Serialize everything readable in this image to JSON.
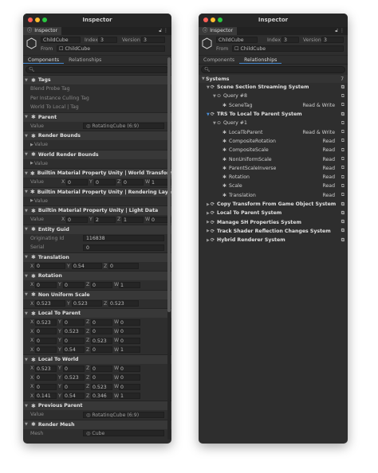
{
  "left": {
    "title": "Inspector",
    "tab_label": "Inspector",
    "entity": {
      "name": "ChildCube",
      "index_label": "Index",
      "index_value": "3",
      "version_label": "Version",
      "version_value": "3",
      "from_label": "From",
      "from_value": "ChildCube"
    },
    "subtabs": [
      "Components",
      "Relationships"
    ],
    "components": [
      {
        "name": "Tags",
        "rows": [
          {
            "text": "Blend Probe Tag"
          },
          {
            "text": "Per Instance Culling Tag"
          },
          {
            "text": "World To Local | Tag"
          }
        ]
      },
      {
        "name": "Parent",
        "rows": [
          {
            "label": "Value",
            "object": "RotatingCube (6:9)"
          }
        ]
      },
      {
        "name": "Render Bounds",
        "rows": [
          {
            "label": "Value",
            "collapsed": true
          }
        ]
      },
      {
        "name": "World Render Bounds",
        "rows": [
          {
            "label": "Value",
            "collapsed": true
          }
        ]
      },
      {
        "name": "Builtin Material Property Unity | World Transform P...",
        "rows": [
          {
            "label": "Value",
            "vec": [
              [
                "X",
                "0"
              ],
              [
                "Y",
                "0"
              ],
              [
                "Z",
                "0"
              ],
              [
                "W",
                "1"
              ]
            ]
          }
        ]
      },
      {
        "name": "Builtin Material Property Unity | Rendering Layer",
        "rows": [
          {
            "label": "Value",
            "collapsed": true
          }
        ]
      },
      {
        "name": "Builtin Material Property Unity | Light Data",
        "rows": [
          {
            "label": "Value",
            "vec": [
              [
                "X",
                "0"
              ],
              [
                "Y",
                "2"
              ],
              [
                "Z",
                "1"
              ],
              [
                "W",
                "0"
              ]
            ]
          }
        ]
      },
      {
        "name": "Entity Guid",
        "rows": [
          {
            "label": "Originating Id",
            "value": "116838"
          },
          {
            "label": "Serial",
            "value": "0"
          }
        ]
      },
      {
        "name": "Translation",
        "rows": [
          {
            "vec": [
              [
                "X",
                "0"
              ],
              [
                "Y",
                "0.54"
              ],
              [
                "Z",
                "0"
              ]
            ]
          }
        ]
      },
      {
        "name": "Rotation",
        "rows": [
          {
            "vec": [
              [
                "X",
                "0"
              ],
              [
                "Y",
                "0"
              ],
              [
                "Z",
                "0"
              ],
              [
                "W",
                "1"
              ]
            ]
          }
        ]
      },
      {
        "name": "Non Uniform Scale",
        "rows": [
          {
            "vec": [
              [
                "X",
                "0.523"
              ],
              [
                "Y",
                "0.523"
              ],
              [
                "Z",
                "0.523"
              ]
            ]
          }
        ]
      },
      {
        "name": "Local To Parent",
        "rows": [
          {
            "vec": [
              [
                "X",
                "0.523"
              ],
              [
                "Y",
                "0"
              ],
              [
                "Z",
                "0"
              ],
              [
                "W",
                "0"
              ]
            ]
          },
          {
            "vec": [
              [
                "X",
                "0"
              ],
              [
                "Y",
                "0.523"
              ],
              [
                "Z",
                "0"
              ],
              [
                "W",
                "0"
              ]
            ]
          },
          {
            "vec": [
              [
                "X",
                "0"
              ],
              [
                "Y",
                "0"
              ],
              [
                "Z",
                "0.523"
              ],
              [
                "W",
                "0"
              ]
            ]
          },
          {
            "vec": [
              [
                "X",
                "0"
              ],
              [
                "Y",
                "0.54"
              ],
              [
                "Z",
                "0"
              ],
              [
                "W",
                "1"
              ]
            ]
          }
        ]
      },
      {
        "name": "Local To World",
        "rows": [
          {
            "vec": [
              [
                "X",
                "0.523"
              ],
              [
                "Y",
                "0"
              ],
              [
                "Z",
                "0"
              ],
              [
                "W",
                "0"
              ]
            ]
          },
          {
            "vec": [
              [
                "X",
                "0"
              ],
              [
                "Y",
                "0.523"
              ],
              [
                "Z",
                "0"
              ],
              [
                "W",
                "0"
              ]
            ]
          },
          {
            "vec": [
              [
                "X",
                "0"
              ],
              [
                "Y",
                "0"
              ],
              [
                "Z",
                "0.523"
              ],
              [
                "W",
                "0"
              ]
            ]
          },
          {
            "vec": [
              [
                "X",
                "0.141"
              ],
              [
                "Y",
                "0.54"
              ],
              [
                "Z",
                "0.346"
              ],
              [
                "W",
                "1"
              ]
            ]
          }
        ]
      },
      {
        "name": "Previous Parent",
        "rows": [
          {
            "label": "Value",
            "object": "RotatingCube (6:9)"
          }
        ]
      },
      {
        "name": "Render Mesh",
        "rows": [
          {
            "label": "Mesh",
            "object": "Cube"
          }
        ]
      }
    ]
  },
  "right": {
    "title": "Inspector",
    "tab_label": "Inspector",
    "entity": {
      "name": "ChildCube",
      "index_label": "Index",
      "index_value": "3",
      "version_label": "Version",
      "version_value": "3",
      "from_label": "From",
      "from_value": "ChildCube"
    },
    "subtabs": [
      "Components",
      "Relationships"
    ],
    "systems_label": "Systems",
    "systems_count": "7",
    "tree": [
      {
        "level": 0,
        "kind": "system",
        "label": "Scene Section Streaming System",
        "expanded": true
      },
      {
        "level": 1,
        "kind": "query",
        "label": "Query #8",
        "expanded": true
      },
      {
        "level": 2,
        "kind": "component",
        "label": "SceneTag",
        "access": "Read & Write"
      },
      {
        "level": 0,
        "kind": "system",
        "label": "TRS To Local To Parent System",
        "expanded": true,
        "highlight": true
      },
      {
        "level": 1,
        "kind": "query",
        "label": "Query #1",
        "expanded": true
      },
      {
        "level": 2,
        "kind": "component",
        "label": "LocalToParent",
        "access": "Read & Write"
      },
      {
        "level": 2,
        "kind": "component",
        "label": "CompositeRotation",
        "access": "Read"
      },
      {
        "level": 2,
        "kind": "component",
        "label": "CompositeScale",
        "access": "Read"
      },
      {
        "level": 2,
        "kind": "component",
        "label": "NonUniformScale",
        "access": "Read"
      },
      {
        "level": 2,
        "kind": "component",
        "label": "ParentScaleInverse",
        "access": "Read"
      },
      {
        "level": 2,
        "kind": "component",
        "label": "Rotation",
        "access": "Read"
      },
      {
        "level": 2,
        "kind": "component",
        "label": "Scale",
        "access": "Read"
      },
      {
        "level": 2,
        "kind": "component",
        "label": "Translation",
        "access": "Read"
      },
      {
        "level": 0,
        "kind": "system",
        "label": "Copy Transform From Game Object System",
        "expanded": false
      },
      {
        "level": 0,
        "kind": "system",
        "label": "Local To Parent System",
        "expanded": false
      },
      {
        "level": 0,
        "kind": "system",
        "label": "Manage SH Properties System",
        "expanded": false
      },
      {
        "level": 0,
        "kind": "system",
        "label": "Track Shader Reflection Changes System",
        "expanded": false
      },
      {
        "level": 0,
        "kind": "system",
        "label": "Hybrid Renderer System",
        "expanded": false
      }
    ]
  },
  "colors": {
    "accent": "#4a8cd4",
    "panel": "#2e2e2e",
    "header": "#383838",
    "close": "#ff5f57",
    "minimize": "#febc2e",
    "zoom": "#28c840"
  },
  "icons": {
    "component": "gear-icon",
    "system": "refresh-icon",
    "query": "query-icon",
    "link": "open-link-icon",
    "search": "search-icon",
    "lock": "lock-icon",
    "menu": "more-icon"
  }
}
